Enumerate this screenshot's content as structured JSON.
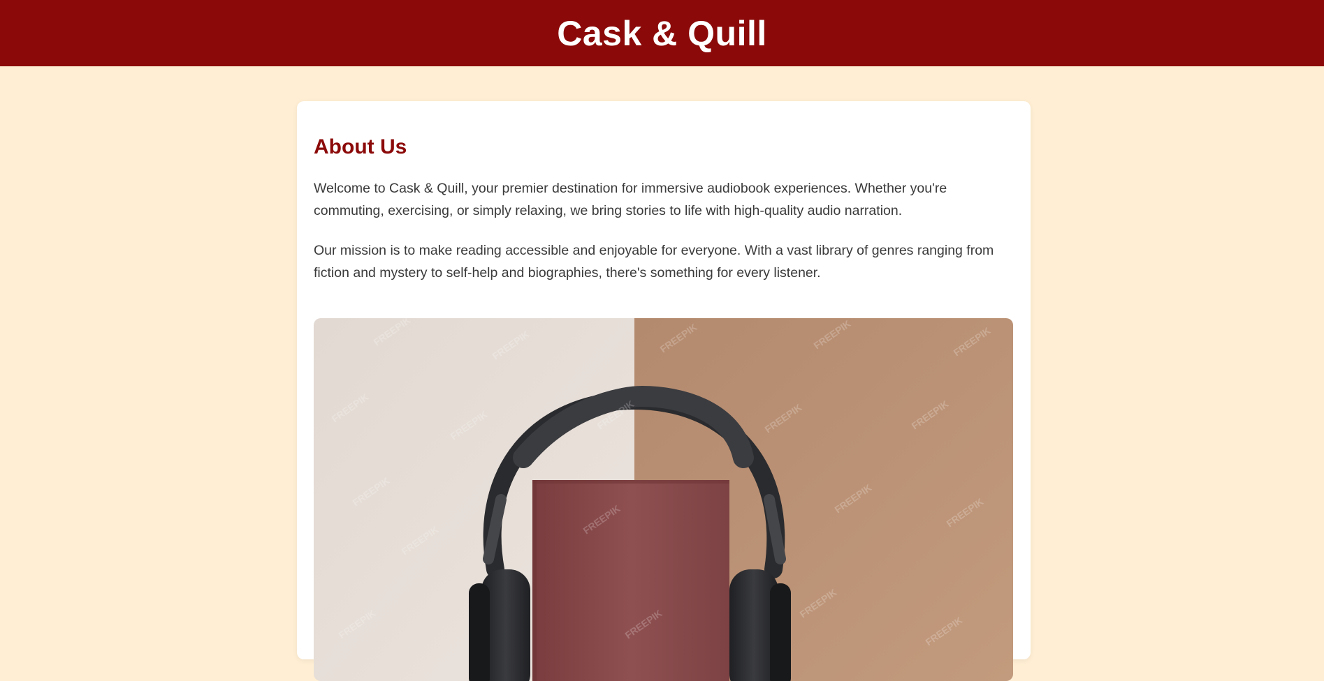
{
  "header": {
    "site_title": "Cask & Quill"
  },
  "about": {
    "heading": "About Us",
    "paragraphs": [
      "Welcome to Cask & Quill, your premier destination for immersive audiobook experiences. Whether you're commuting, exercising, or simply relaxing, we bring stories to life with high-quality audio narration.",
      "Our mission is to make reading accessible and enjoyable for everyone. With a vast library of genres ranging from fiction and mystery to self-help and biographies, there's something for every listener."
    ],
    "image": {
      "subject": "headphones-on-book-icon",
      "watermark": "FREEPIK"
    }
  },
  "colors": {
    "header_bg": "#8b0a09",
    "page_bg": "#ffeed3",
    "heading": "#8b0a09",
    "body_text": "#3a3a3a",
    "image_left_bg": "#e6ddd6",
    "image_right_bg": "#b98f72",
    "book": "#8a4b4c",
    "headphones": "#2a2b2e"
  }
}
